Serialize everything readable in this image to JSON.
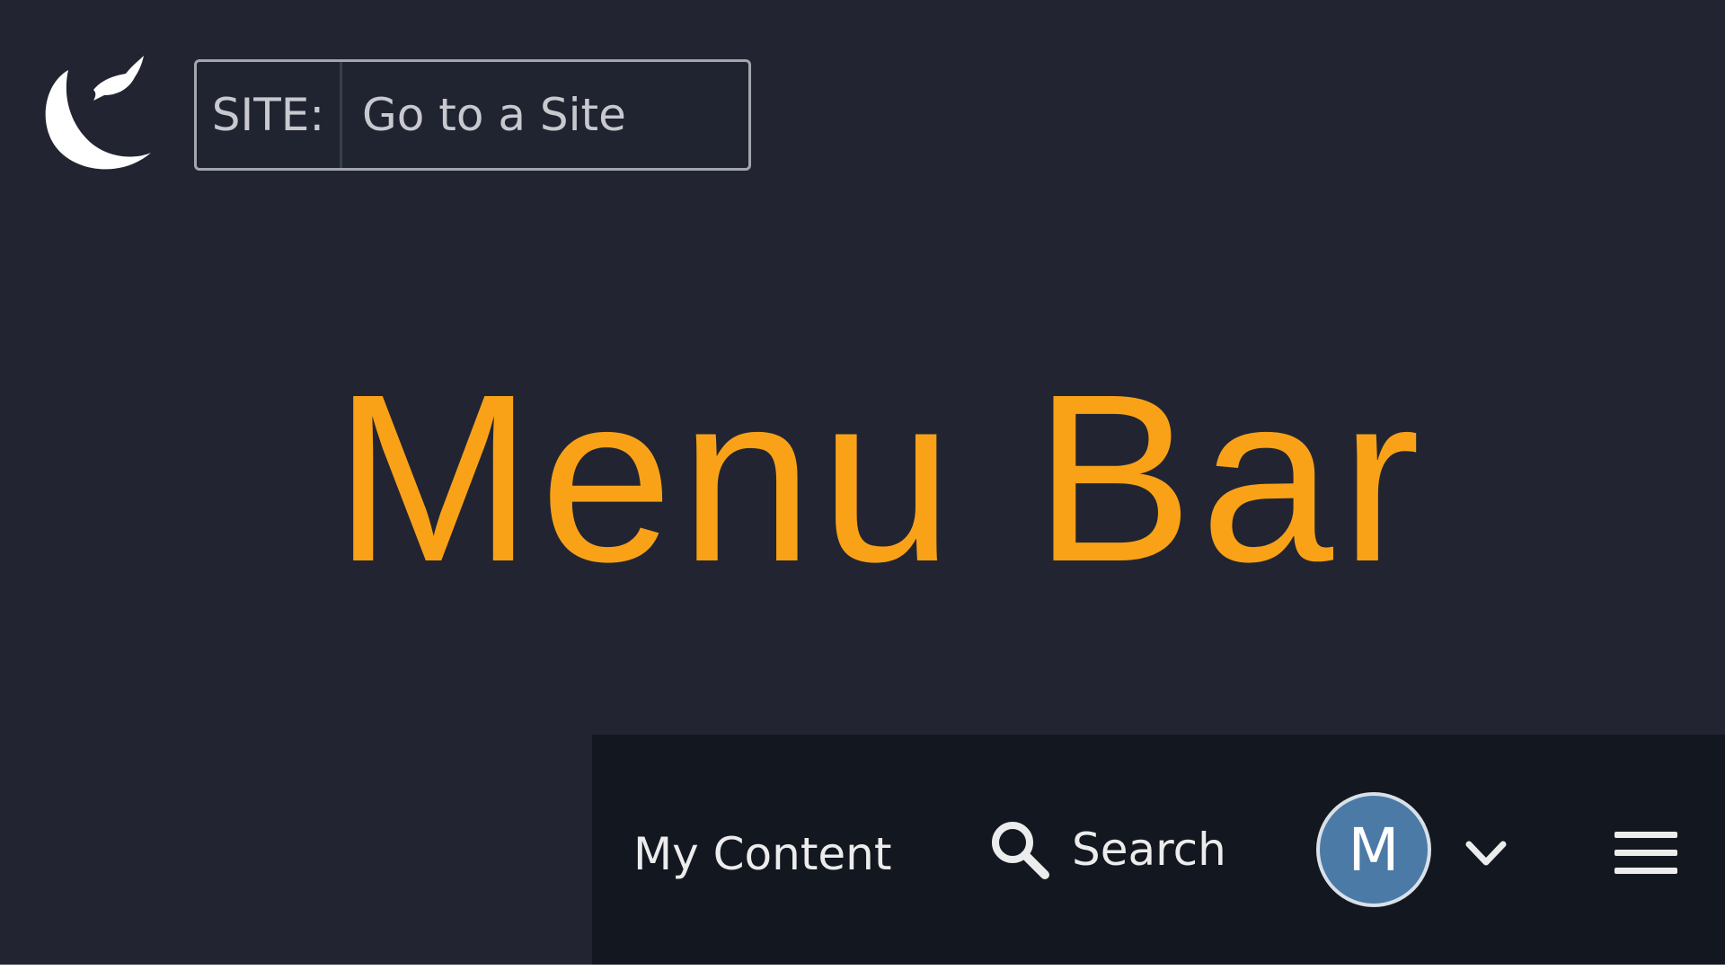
{
  "header": {
    "logo_icon": "crescent-bird-logo-icon",
    "site_picker": {
      "label": "SITE:",
      "value": "Go to a Site"
    }
  },
  "overlay": {
    "title": "Menu Bar",
    "color": "#f9a218"
  },
  "menubar": {
    "my_content_label": "My Content",
    "search_label": "Search",
    "search_icon": "search-icon",
    "avatar_initial": "M",
    "avatar_color": "#4b7aa6",
    "dropdown_icon": "chevron-down-icon",
    "menu_icon": "hamburger-menu-icon"
  }
}
